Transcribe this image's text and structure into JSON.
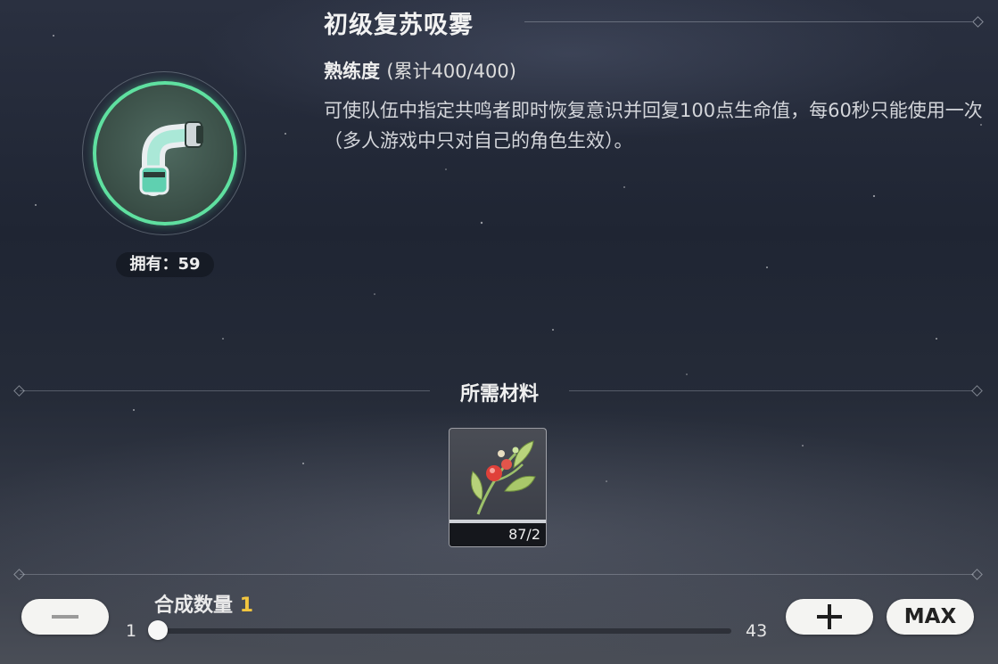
{
  "item": {
    "title": "初级复苏吸雾",
    "proficiency_label": "熟练度",
    "proficiency_value": "(累计400/400)",
    "description": "可使队伍中指定共鸣者即时恢复意识并回复100点生命值，每60秒只能使用一次（多人游戏中只对自己的角色生效）。",
    "owned": "拥有：59",
    "icon": "inhaler-icon"
  },
  "materials": {
    "title": "所需材料",
    "items": [
      {
        "icon": "red-berry-herb-icon",
        "count": "87/2"
      }
    ]
  },
  "craft": {
    "quantity_label": "合成数量",
    "quantity_value": "1",
    "min": "1",
    "max": "43",
    "quantity_fraction": 0.0,
    "minus_icon": "minus-icon",
    "plus_icon": "plus-icon",
    "max_label": "MAX"
  },
  "colors": {
    "ring": "#5fe0a0",
    "quantity_accent": "#f3c63f"
  }
}
